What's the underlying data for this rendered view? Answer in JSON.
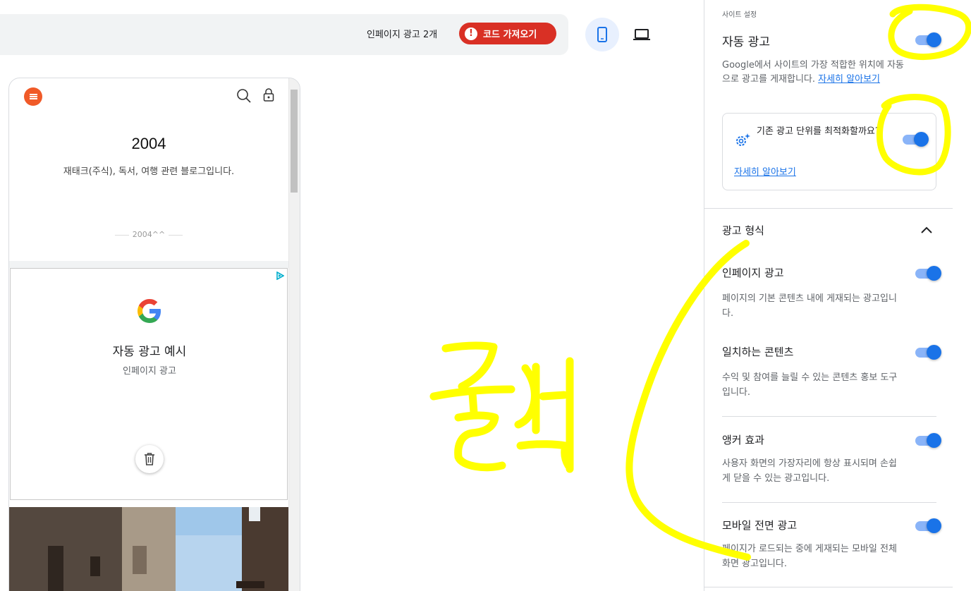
{
  "toolbar": {
    "ad_count_label": "인페이지 광고 2개",
    "get_code_label": "코드 가져오기",
    "warn_glyph": "!"
  },
  "preview": {
    "blog_title": "2004",
    "blog_description": "재태크(주식), 독서, 여행 관련 블로그입니다.",
    "blog_subtitle": "2004^^",
    "ad_example_title": "자동 광고 예시",
    "ad_example_subtitle": "인페이지 광고"
  },
  "panel": {
    "section_label": "사이트 설정",
    "auto_ads_title": "자동 광고",
    "auto_ads_desc": "Google에서 사이트의 가장 적합한 위치에 자동으로 광고를 게재합니다. ",
    "learn_more": "자세히 알아보기",
    "optimize_question": "기존 광고 단위를 최적화할까요?",
    "optimize_link": "자세히 알아보기",
    "format_title": "광고 형식",
    "formats": [
      {
        "title": "인페이지 광고",
        "desc": "페이지의 기본 콘텐츠 내에 게재되는 광고입니다."
      },
      {
        "title": "일치하는 콘텐츠",
        "desc": "수익 및 참여를 늘릴 수 있는 콘텐츠 홍보 도구입니다."
      },
      {
        "title": "앵커 효과",
        "desc": "사용자 화면의 가장자리에 항상 표시되며 손쉽게 닫을 수 있는 광고입니다."
      },
      {
        "title": "모바일 전면 광고",
        "desc": "페이지가 로드되는 중에 게재되는 모바일 전체 화면 광고입니다."
      }
    ],
    "toggles": {
      "auto_ads": true,
      "optimize_existing": true,
      "in_page": true,
      "matched_content": true,
      "anchor": true,
      "vignette": true
    }
  },
  "annotation": {
    "handwritten_text": "클릭",
    "color": "#ffff00"
  },
  "colors": {
    "accent": "#1a73e8",
    "danger": "#d93025",
    "menu_orange": "#f05a28"
  }
}
